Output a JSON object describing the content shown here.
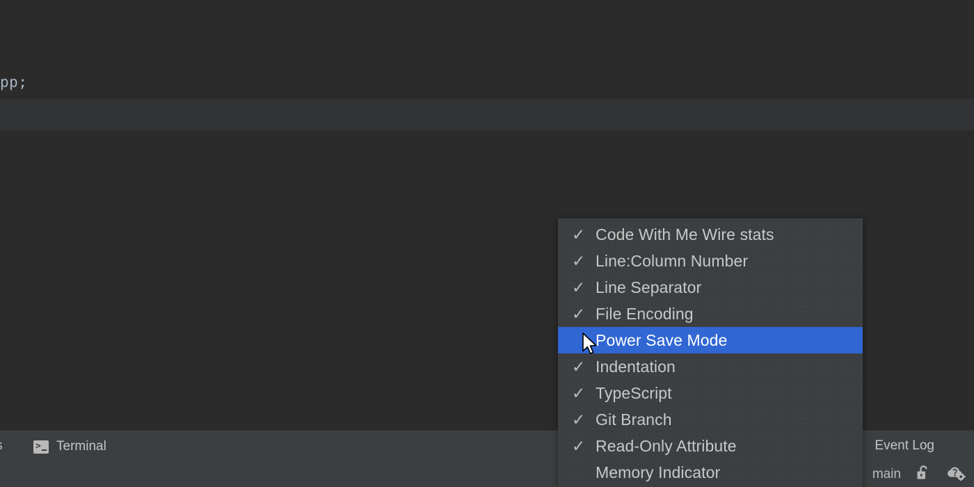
{
  "editor": {
    "code_fragment": "pp;",
    "code_tail": ""
  },
  "toolwindow": {
    "partial_tab_label": "s",
    "terminal_tab": {
      "label": "Terminal",
      "icon": "terminal-icon"
    },
    "event_log_tab": {
      "label": "Event Log"
    }
  },
  "status_bar": {
    "branch": "main",
    "icons": [
      {
        "name": "unlocked-padlock-icon"
      },
      {
        "name": "cloud-question-gear-icon"
      }
    ]
  },
  "popup_menu": {
    "name": "status-bar-widgets-menu",
    "items": [
      {
        "label": "Code With Me Wire stats",
        "checked": true,
        "selected": false
      },
      {
        "label": "Line:Column Number",
        "checked": true,
        "selected": false
      },
      {
        "label": "Line Separator",
        "checked": true,
        "selected": false
      },
      {
        "label": "File Encoding",
        "checked": true,
        "selected": false
      },
      {
        "label": "Power Save Mode",
        "checked": false,
        "selected": true
      },
      {
        "label": "Indentation",
        "checked": true,
        "selected": false
      },
      {
        "label": "TypeScript",
        "checked": true,
        "selected": false
      },
      {
        "label": "Git Branch",
        "checked": true,
        "selected": false
      },
      {
        "label": "Read-Only Attribute",
        "checked": true,
        "selected": false
      },
      {
        "label": "Memory Indicator",
        "checked": false,
        "selected": false
      }
    ],
    "check_glyph": "✓"
  },
  "colors": {
    "window_background": "#2b2b2b",
    "panel_background": "#313335",
    "menu_background": "#3c3f41",
    "selection_blue": "#3167d3",
    "text_primary": "#c8c8c8",
    "text_selected": "#ffffff"
  }
}
